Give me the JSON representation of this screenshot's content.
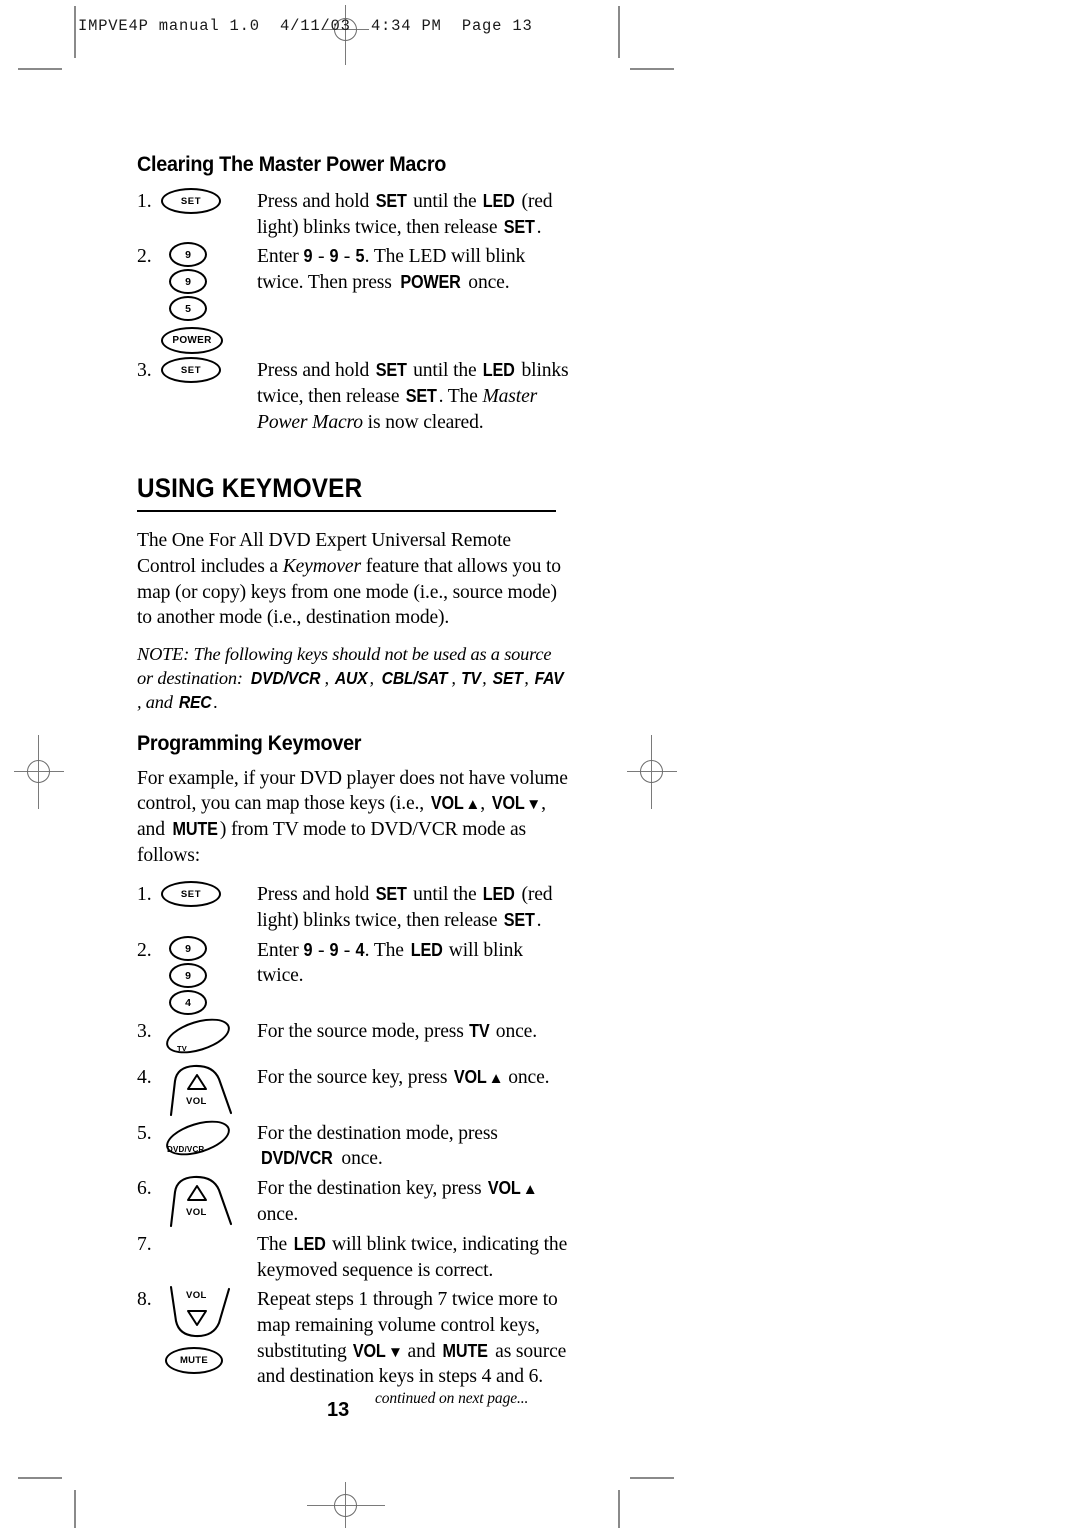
{
  "printer_marks": {
    "slug": "IMPVE4P manual 1.0  4/11/03  4:34 PM  Page 13"
  },
  "section_one": {
    "heading": "Clearing The Master Power Macro",
    "steps": [
      {
        "num": "1.",
        "keys": [
          {
            "type": "pill",
            "label": "SET",
            "style": "set"
          }
        ],
        "text_parts": [
          {
            "t": "Press and hold ",
            "s": "plain"
          },
          {
            "t": "SET",
            "s": "key"
          },
          {
            "t": " until the ",
            "s": "plain"
          },
          {
            "t": "LED",
            "s": "key"
          },
          {
            "t": " (red light) blinks twice, then release ",
            "s": "plain"
          },
          {
            "t": "SET",
            "s": "key"
          },
          {
            "t": ".",
            "s": "plain"
          }
        ]
      },
      {
        "num": "2.",
        "keys": [
          {
            "type": "pill",
            "label": "9",
            "style": "num"
          },
          {
            "type": "pill",
            "label": "9",
            "style": "num"
          },
          {
            "type": "pill",
            "label": "5",
            "style": "num"
          },
          {
            "type": "pill",
            "label": "POWER",
            "style": "power"
          }
        ],
        "text_parts": [
          {
            "t": "Enter ",
            "s": "plain"
          },
          {
            "t": "9",
            "s": "key"
          },
          {
            "t": " - ",
            "s": "plain"
          },
          {
            "t": "9",
            "s": "key"
          },
          {
            "t": " - ",
            "s": "plain"
          },
          {
            "t": "5",
            "s": "key"
          },
          {
            "t": ". The LED will blink twice. Then press ",
            "s": "plain"
          },
          {
            "t": "POWER",
            "s": "key"
          },
          {
            "t": " once.",
            "s": "plain"
          }
        ]
      },
      {
        "num": "3.",
        "keys": [
          {
            "type": "pill",
            "label": "SET",
            "style": "set"
          }
        ],
        "text_parts": [
          {
            "t": "Press and hold ",
            "s": "plain"
          },
          {
            "t": "SET",
            "s": "key"
          },
          {
            "t": " until the ",
            "s": "plain"
          },
          {
            "t": "LED",
            "s": "key"
          },
          {
            "t": " blinks twice, then release ",
            "s": "plain"
          },
          {
            "t": "SET",
            "s": "key"
          },
          {
            "t": ". The ",
            "s": "plain"
          },
          {
            "t": "Master Power Macro",
            "s": "italic"
          },
          {
            "t": " is now cleared.",
            "s": "plain"
          }
        ]
      }
    ]
  },
  "section_two": {
    "heading": "USING KEYMOVER",
    "intro_parts": [
      {
        "t": "The One For All DVD Expert Universal Remote Control includes a ",
        "s": "plain"
      },
      {
        "t": "Keymover",
        "s": "italic"
      },
      {
        "t": " feature that allows you to map (or copy) keys from one mode (i.e., source mode) to another mode (i.e., destination mode).",
        "s": "plain"
      }
    ],
    "note_parts": [
      {
        "t": "NOTE: The following keys should not be used as a source or destination: ",
        "s": "plain"
      },
      {
        "t": "DVD/VCR",
        "s": "keyi"
      },
      {
        "t": ", ",
        "s": "plain"
      },
      {
        "t": "AUX",
        "s": "keyi"
      },
      {
        "t": ", ",
        "s": "plain"
      },
      {
        "t": "CBL/SAT",
        "s": "keyi"
      },
      {
        "t": ", ",
        "s": "plain"
      },
      {
        "t": "TV",
        "s": "keyi"
      },
      {
        "t": ", ",
        "s": "plain"
      },
      {
        "t": "SET",
        "s": "keyi"
      },
      {
        "t": ", ",
        "s": "plain"
      },
      {
        "t": "FAV",
        "s": "keyi"
      },
      {
        "t": ", and ",
        "s": "plain"
      },
      {
        "t": "REC",
        "s": "keyi"
      },
      {
        "t": ".",
        "s": "plain"
      }
    ]
  },
  "section_three": {
    "heading": "Programming Keymover",
    "intro_parts": [
      {
        "t": "For example, if your DVD player does not have volume control, you can map those keys (i.e., ",
        "s": "plain"
      },
      {
        "t": "VOL",
        "s": "key-up"
      },
      {
        "t": ", ",
        "s": "plain"
      },
      {
        "t": "VOL",
        "s": "key-down"
      },
      {
        "t": ", and ",
        "s": "plain"
      },
      {
        "t": "MUTE",
        "s": "key"
      },
      {
        "t": ") from TV mode to DVD/VCR mode as follows:",
        "s": "plain"
      }
    ],
    "steps": [
      {
        "num": "1.",
        "keys": [
          {
            "type": "pill",
            "label": "SET",
            "style": "set"
          }
        ],
        "text_parts": [
          {
            "t": "Press and hold ",
            "s": "plain"
          },
          {
            "t": "SET",
            "s": "key"
          },
          {
            "t": " until the ",
            "s": "plain"
          },
          {
            "t": "LED",
            "s": "key"
          },
          {
            "t": " (red light) blinks twice, then release ",
            "s": "plain"
          },
          {
            "t": "SET",
            "s": "key"
          },
          {
            "t": ".",
            "s": "plain"
          }
        ]
      },
      {
        "num": "2.",
        "keys": [
          {
            "type": "pill",
            "label": "9",
            "style": "num"
          },
          {
            "type": "pill",
            "label": "9",
            "style": "num"
          },
          {
            "type": "pill",
            "label": "4",
            "style": "num"
          }
        ],
        "text_parts": [
          {
            "t": "Enter ",
            "s": "plain"
          },
          {
            "t": "9",
            "s": "key"
          },
          {
            "t": " - ",
            "s": "plain"
          },
          {
            "t": "9",
            "s": "key"
          },
          {
            "t": " - ",
            "s": "plain"
          },
          {
            "t": "4",
            "s": "key"
          },
          {
            "t": ". The ",
            "s": "plain"
          },
          {
            "t": "LED",
            "s": "key"
          },
          {
            "t": " will blink twice.",
            "s": "plain"
          }
        ]
      },
      {
        "num": "3.",
        "keys": [
          {
            "type": "mode",
            "label": "TV"
          }
        ],
        "text_parts": [
          {
            "t": "For the source mode, press ",
            "s": "plain"
          },
          {
            "t": "TV",
            "s": "key"
          },
          {
            "t": " once.",
            "s": "plain"
          }
        ]
      },
      {
        "num": "4.",
        "keys": [
          {
            "type": "rocker",
            "label": "VOL",
            "dir": "up"
          }
        ],
        "text_parts": [
          {
            "t": "For the source key, press ",
            "s": "plain"
          },
          {
            "t": "VOL",
            "s": "key-up"
          },
          {
            "t": " once.",
            "s": "plain"
          }
        ]
      },
      {
        "num": "5.",
        "keys": [
          {
            "type": "mode",
            "label": "DVD/VCR"
          }
        ],
        "text_parts": [
          {
            "t": "For the destination mode, press ",
            "s": "plain"
          },
          {
            "t": "DVD/VCR",
            "s": "key"
          },
          {
            "t": " once.",
            "s": "plain"
          }
        ]
      },
      {
        "num": "6.",
        "keys": [
          {
            "type": "rocker",
            "label": "VOL",
            "dir": "up"
          }
        ],
        "text_parts": [
          {
            "t": "For the destination key, press ",
            "s": "plain"
          },
          {
            "t": "VOL",
            "s": "key-up"
          },
          {
            "t": " once.",
            "s": "plain"
          }
        ]
      },
      {
        "num": "7.",
        "keys": [],
        "text_parts": [
          {
            "t": "The ",
            "s": "plain"
          },
          {
            "t": "LED",
            "s": "key"
          },
          {
            "t": " will blink twice, indicating the keymoved sequence is correct.",
            "s": "plain"
          }
        ]
      },
      {
        "num": "8.",
        "keys": [
          {
            "type": "rocker",
            "label": "VOL",
            "dir": "down"
          },
          {
            "type": "pill",
            "label": "MUTE",
            "style": "mute"
          }
        ],
        "text_parts": [
          {
            "t": "Repeat steps 1 through 7 twice more to map remaining volume control keys, substituting ",
            "s": "plain"
          },
          {
            "t": "VOL",
            "s": "key-down"
          },
          {
            "t": " and ",
            "s": "plain"
          },
          {
            "t": "MUTE",
            "s": "key"
          },
          {
            "t": " as source and destination keys in steps 4 and 6.",
            "s": "plain"
          }
        ]
      }
    ]
  },
  "footer": {
    "page_number": "13",
    "continued": "continued on next page..."
  }
}
